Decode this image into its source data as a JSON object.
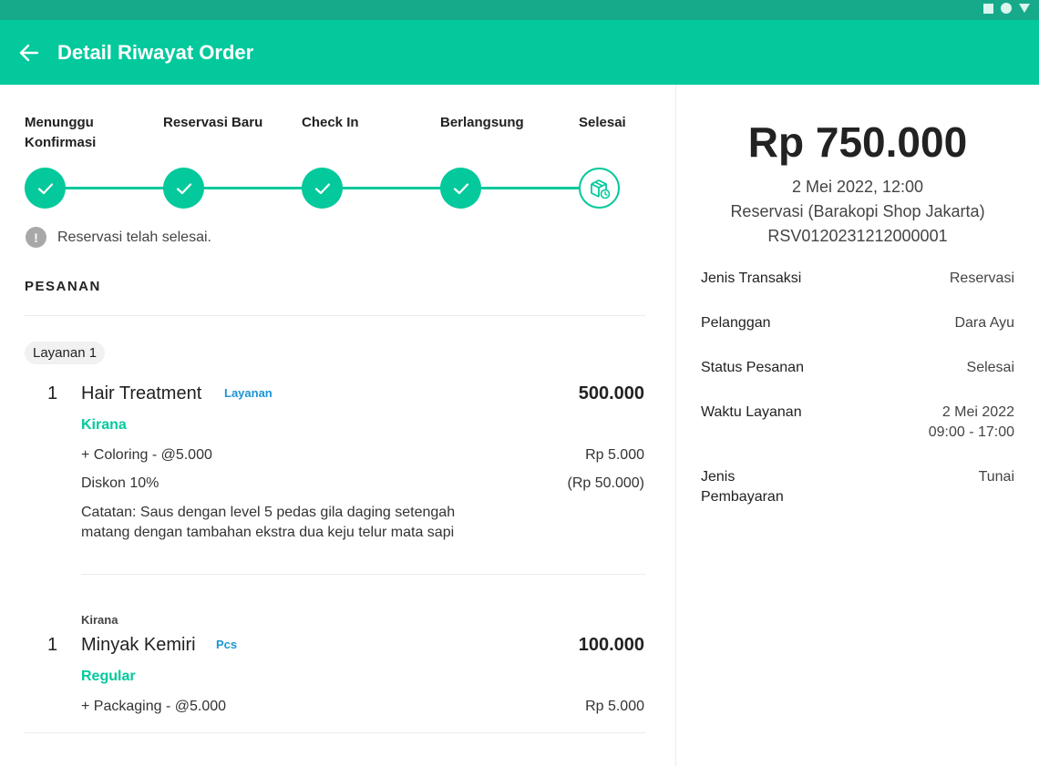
{
  "header": {
    "title": "Detail Riwayat Order"
  },
  "steps": [
    {
      "label_line1": "Menunggu",
      "label_line2": "Konfirmasi"
    },
    {
      "label_line1": "Reservasi Baru",
      "label_line2": ""
    },
    {
      "label_line1": "Check In",
      "label_line2": ""
    },
    {
      "label_line1": "Berlangsung",
      "label_line2": ""
    },
    {
      "label_line1": "Selesai",
      "label_line2": ""
    }
  ],
  "status_message": "Reservasi telah selesai.",
  "order": {
    "section_title": "PESANAN",
    "group_chip": "Layanan 1",
    "items": [
      {
        "qty": "1",
        "name": "Hair Treatment",
        "unit": "Layanan",
        "price": "500.000",
        "variant": "Kirana",
        "addon": "+ Coloring - @5.000",
        "addon_price": "Rp 5.000",
        "discount": "Diskon 10%",
        "discount_value": "(Rp 50.000)",
        "note_line1": "Catatan: Saus dengan level 5 pedas gila daging setengah",
        "note_line2": "matang dengan tambahan ekstra dua keju telur mata sapi"
      },
      {
        "staff": "Kirana",
        "qty": "1",
        "name": "Minyak Kemiri",
        "unit": "Pcs",
        "price": "100.000",
        "variant": "Regular",
        "addon": "+ Packaging - @5.000",
        "addon_price": "Rp 5.000"
      }
    ]
  },
  "summary": {
    "total": "Rp 750.000",
    "datetime": "2 Mei 2022, 12:00",
    "type_line": "Reservasi (Barakopi Shop Jakarta)",
    "code": "RSV0120231212000001",
    "details": [
      {
        "label": "Jenis Transaksi",
        "value": "Reservasi"
      },
      {
        "label": "Pelanggan",
        "value": "Dara Ayu"
      },
      {
        "label": "Status Pesanan",
        "value": "Selesai"
      },
      {
        "label": "Waktu Layanan",
        "value_line1": "2 Mei 2022",
        "value_line2": "09:00 - 17:00"
      },
      {
        "label_line1": "Jenis",
        "label_line2": "Pembayaran",
        "value": "Tunai"
      }
    ]
  },
  "colors": {
    "primary": "#03c99c",
    "statusbar": "#16a98a",
    "unit_tag": "#1c95d6"
  },
  "icons": [
    "back-arrow-icon",
    "check-icon",
    "package-clock-icon",
    "info-icon"
  ]
}
